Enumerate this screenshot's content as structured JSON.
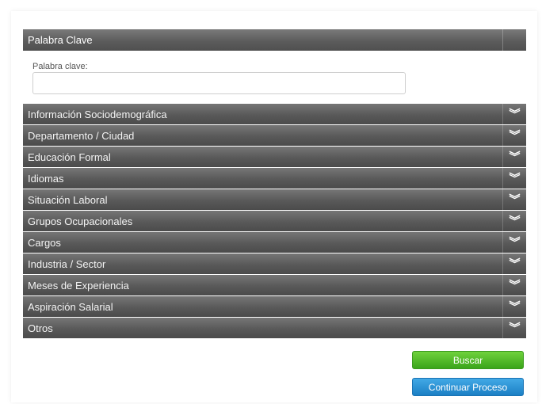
{
  "keyword_section": {
    "title": "Palabra Clave",
    "field_label": "Palabra clave:",
    "field_value": "",
    "field_placeholder": ""
  },
  "accordion": {
    "items": [
      {
        "label": "Información Sociodemográfica",
        "icon": "chevron-double-down-icon"
      },
      {
        "label": "Departamento / Ciudad",
        "icon": "chevron-double-down-icon"
      },
      {
        "label": "Educación Formal",
        "icon": "chevron-double-down-icon"
      },
      {
        "label": "Idiomas",
        "icon": "chevron-double-down-icon"
      },
      {
        "label": "Situación Laboral",
        "icon": "chevron-double-down-icon"
      },
      {
        "label": "Grupos Ocupacionales",
        "icon": "chevron-double-down-icon"
      },
      {
        "label": "Cargos",
        "icon": "chevron-double-down-icon"
      },
      {
        "label": "Industria / Sector",
        "icon": "chevron-double-down-icon"
      },
      {
        "label": "Meses de Experiencia",
        "icon": "chevron-double-down-icon"
      },
      {
        "label": "Aspiración Salarial",
        "icon": "chevron-double-down-icon"
      },
      {
        "label": "Otros",
        "icon": "chevron-double-down-icon"
      }
    ]
  },
  "actions": {
    "search_label": "Buscar",
    "continue_label": "Continuar Proceso"
  },
  "colors": {
    "header_bar": "#5c5c5c",
    "search_button": "#3aa51a",
    "continue_button": "#1b7fc4"
  }
}
